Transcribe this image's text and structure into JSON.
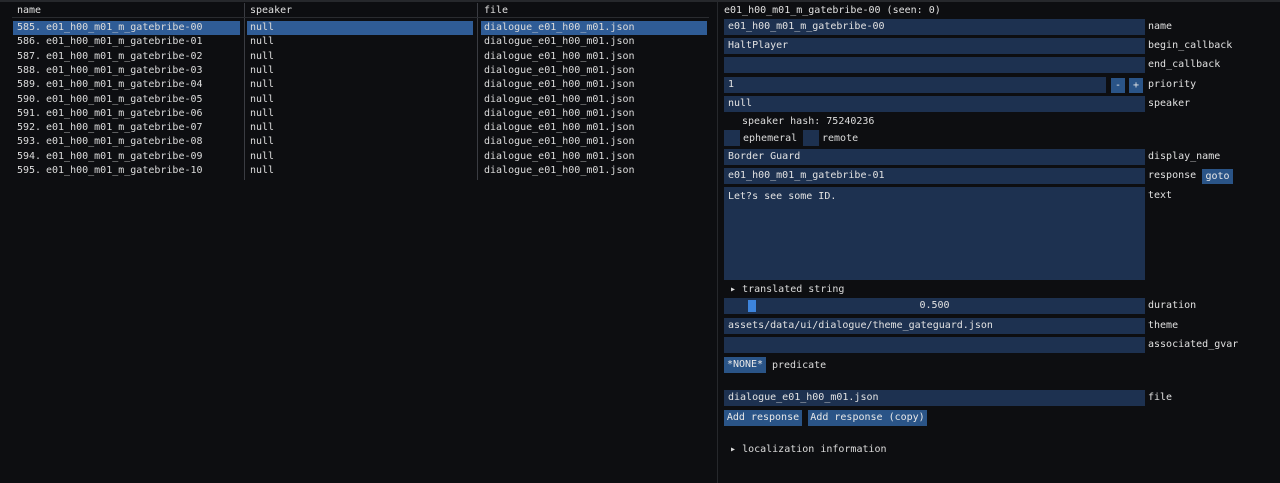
{
  "table": {
    "headers": {
      "name": "name",
      "speaker": "speaker",
      "file": "file"
    },
    "rows": [
      {
        "index": "585.",
        "name": "e01_h00_m01_m_gatebribe-00",
        "speaker": "null",
        "file": "dialogue_e01_h00_m01.json",
        "selected": true
      },
      {
        "index": "586.",
        "name": "e01_h00_m01_m_gatebribe-01",
        "speaker": "null",
        "file": "dialogue_e01_h00_m01.json"
      },
      {
        "index": "587.",
        "name": "e01_h00_m01_m_gatebribe-02",
        "speaker": "null",
        "file": "dialogue_e01_h00_m01.json"
      },
      {
        "index": "588.",
        "name": "e01_h00_m01_m_gatebribe-03",
        "speaker": "null",
        "file": "dialogue_e01_h00_m01.json"
      },
      {
        "index": "589.",
        "name": "e01_h00_m01_m_gatebribe-04",
        "speaker": "null",
        "file": "dialogue_e01_h00_m01.json"
      },
      {
        "index": "590.",
        "name": "e01_h00_m01_m_gatebribe-05",
        "speaker": "null",
        "file": "dialogue_e01_h00_m01.json"
      },
      {
        "index": "591.",
        "name": "e01_h00_m01_m_gatebribe-06",
        "speaker": "null",
        "file": "dialogue_e01_h00_m01.json"
      },
      {
        "index": "592.",
        "name": "e01_h00_m01_m_gatebribe-07",
        "speaker": "null",
        "file": "dialogue_e01_h00_m01.json"
      },
      {
        "index": "593.",
        "name": "e01_h00_m01_m_gatebribe-08",
        "speaker": "null",
        "file": "dialogue_e01_h00_m01.json"
      },
      {
        "index": "594.",
        "name": "e01_h00_m01_m_gatebribe-09",
        "speaker": "null",
        "file": "dialogue_e01_h00_m01.json"
      },
      {
        "index": "595.",
        "name": "e01_h00_m01_m_gatebribe-10",
        "speaker": "null",
        "file": "dialogue_e01_h00_m01.json"
      }
    ]
  },
  "editor": {
    "title": "e01_h00_m01_m_gatebribe-00 (seen: 0)",
    "name": {
      "value": "e01_h00_m01_m_gatebribe-00",
      "label": "name"
    },
    "begin_callback": {
      "value": "HaltPlayer",
      "label": "begin_callback"
    },
    "end_callback": {
      "value": "",
      "label": "end_callback"
    },
    "priority": {
      "value": "1",
      "label": "priority",
      "minus": "-",
      "plus": "+"
    },
    "speaker": {
      "value": "null",
      "label": "speaker"
    },
    "speaker_hash": "speaker hash: 75240236",
    "ephemeral_label": "ephemeral",
    "remote_label": "remote",
    "display_name": {
      "value": "Border Guard",
      "label": "display_name"
    },
    "response": {
      "value": "e01_h00_m01_m_gatebribe-01",
      "label": "response",
      "goto": "goto"
    },
    "text": {
      "value": "Let?s see some ID.",
      "label": "text"
    },
    "translated_string": "translated string",
    "duration": {
      "value": "0.500",
      "label": "duration",
      "fraction": 0.05
    },
    "theme": {
      "value": "assets/data/ui/dialogue/theme_gateguard.json",
      "label": "theme"
    },
    "associated_gvar": {
      "value": "",
      "label": "associated_gvar"
    },
    "predicate": {
      "button": "*NONE*",
      "label": "predicate"
    },
    "file": {
      "value": "dialogue_e01_h00_m01.json",
      "label": "file"
    },
    "add_response": "Add response",
    "add_response_copy": "Add response (copy)",
    "localization_information": "localization information",
    "tree_arrow": "▸"
  },
  "colors": {
    "background": "#0d0e11",
    "field": "#1d3150",
    "selection": "#2f5c96",
    "button": "#2a5487",
    "slider_grab": "#3d84dc"
  }
}
